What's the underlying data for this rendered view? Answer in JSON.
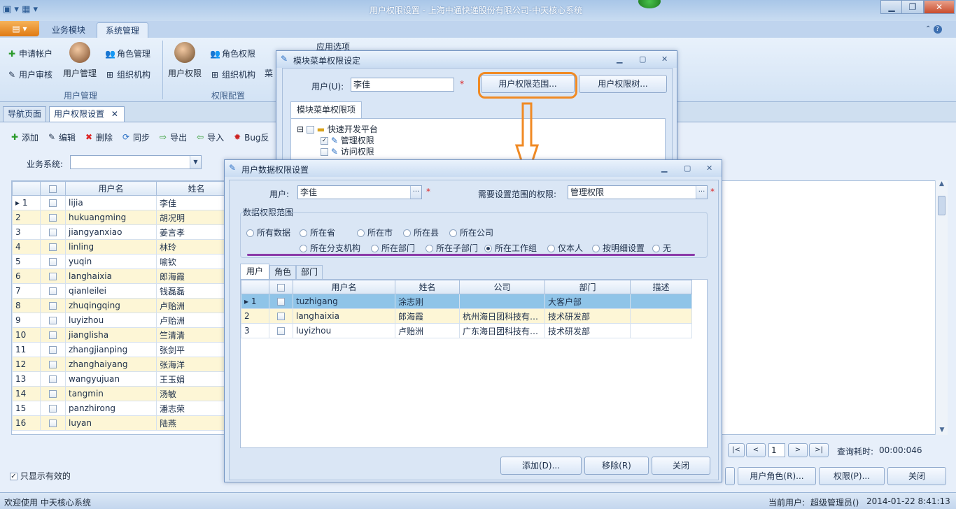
{
  "window": {
    "title": "用户权限设置 - 上海中通快递股份有限公司-中天核心系统"
  },
  "ribbon": {
    "tabs": [
      "业务模块",
      "系统管理"
    ],
    "groups": {
      "user_mgmt": {
        "label": "用户管理",
        "apply_account": "申请帐户",
        "user_audit": "用户审核",
        "user_manage": "用户管理",
        "role_manage": "角色管理",
        "org": "组织机构"
      },
      "perm_config": {
        "label": "权限配置",
        "user_perm": "用户权限",
        "role_perm": "角色权限",
        "org": "组织机构",
        "menu": "菜"
      },
      "app_options": "应用选项"
    }
  },
  "doc_tabs": [
    "导航页面",
    "用户权限设置"
  ],
  "toolbar": {
    "add": "添加",
    "edit": "编辑",
    "delete": "删除",
    "sync": "同步",
    "export": "导出",
    "import": "导入",
    "bug": "Bug反"
  },
  "filter": {
    "system_label": "业务系统:",
    "system_value": ""
  },
  "main_grid": {
    "headers": [
      "用户名",
      "姓名"
    ],
    "rows": [
      {
        "no": "1",
        "username": "lijia",
        "name": "李佳"
      },
      {
        "no": "2",
        "username": "hukuangming",
        "name": "胡况明"
      },
      {
        "no": "3",
        "username": "jiangyanxiao",
        "name": "姜言孝"
      },
      {
        "no": "4",
        "username": "linling",
        "name": "林玲"
      },
      {
        "no": "5",
        "username": "yuqin",
        "name": "喻钦"
      },
      {
        "no": "6",
        "username": "langhaixia",
        "name": "郎海霞"
      },
      {
        "no": "7",
        "username": "qianleilei",
        "name": "钱磊磊"
      },
      {
        "no": "8",
        "username": "zhuqingqing",
        "name": "卢贻洲"
      },
      {
        "no": "9",
        "username": "luyizhou",
        "name": "卢贻洲"
      },
      {
        "no": "10",
        "username": "jianglisha",
        "name": "竺清清"
      },
      {
        "no": "11",
        "username": "zhangjianping",
        "name": "张剑平"
      },
      {
        "no": "12",
        "username": "zhanghaiyang",
        "name": "张海洋"
      },
      {
        "no": "13",
        "username": "wangyujuan",
        "name": "王玉娟"
      },
      {
        "no": "14",
        "username": "tangmin",
        "name": "汤敏"
      },
      {
        "no": "15",
        "username": "panzhirong",
        "name": "潘志荣"
      },
      {
        "no": "16",
        "username": "luyan",
        "name": "陆燕"
      }
    ]
  },
  "only_valid_label": "只显示有效的",
  "pager": {
    "page": "1",
    "elapsed_label": "查询耗时:",
    "elapsed_value": "00:00:046"
  },
  "bottom_buttons": {
    "user_role": "用户角色(R)...",
    "perm": "权限(P)...",
    "close": "关闭"
  },
  "status": {
    "left": "欢迎使用 中天核心系统",
    "current_user_label": "当前用户:",
    "current_user": "超级管理员()",
    "datetime": "2014-01-22 8:41:13"
  },
  "module_dialog": {
    "title": "模块菜单权限设定",
    "user_label": "用户(U):",
    "user_value": "李佳",
    "scope_button": "用户权限范围...",
    "tree_button": "用户权限树...",
    "tab": "模块菜单权限项",
    "tree": {
      "root": "快速开发平台",
      "children": [
        "管理权限",
        "访问权限"
      ]
    }
  },
  "data_dialog": {
    "title": "用户数据权限设置",
    "user_label": "用户:",
    "user_value": "李佳",
    "perm_label": "需要设置范围的权限:",
    "perm_value": "管理权限",
    "scope_group": "数据权限范围",
    "options_row1": [
      "所有数据",
      "所在省",
      "所在市",
      "所在县",
      "所在公司"
    ],
    "options_row2": [
      "所在分支机构",
      "所在部门",
      "所在子部门",
      "所在工作组",
      "仅本人",
      "按明细设置",
      "无"
    ],
    "selected": "所在工作组",
    "tabs": [
      "用户",
      "角色",
      "部门"
    ],
    "grid_headers": [
      "用户名",
      "姓名",
      "公司",
      "部门",
      "描述"
    ],
    "grid_rows": [
      {
        "no": "1",
        "username": "tuzhigang",
        "name": "涂志刚",
        "company": "",
        "dept": "大客户部",
        "desc": ""
      },
      {
        "no": "2",
        "username": "langhaixia",
        "name": "郎海霞",
        "company": "杭州海日团科技有…",
        "dept": "技术研发部",
        "desc": ""
      },
      {
        "no": "3",
        "username": "luyizhou",
        "name": "卢贻洲",
        "company": "广东海日团科技有…",
        "dept": "技术研发部",
        "desc": ""
      }
    ],
    "buttons": {
      "add": "添加(D)...",
      "remove": "移除(R)",
      "close": "关闭"
    }
  },
  "colors": {
    "highlight_orange": "#f08a24",
    "underline_purple": "#8a3aa8"
  }
}
